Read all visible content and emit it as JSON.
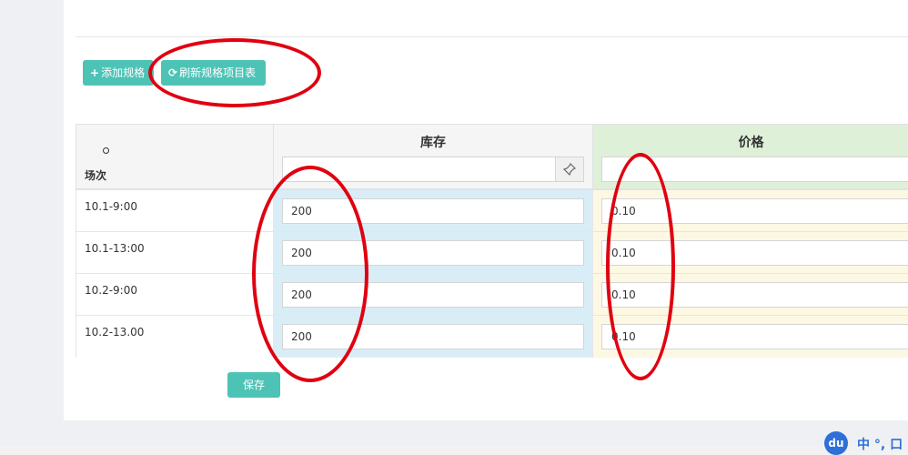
{
  "toolbar": {
    "add_label": "添加规格",
    "add_icon": "plus-icon",
    "refresh_label": "刷新规格项目表",
    "refresh_icon": "refresh-icon"
  },
  "table": {
    "row_header_label": "场次",
    "columns": [
      {
        "title": "库存"
      },
      {
        "title": "价格"
      }
    ],
    "rows": [
      {
        "name": "10.1-9:00",
        "stock": "200",
        "price": "0.10"
      },
      {
        "name": "10.1-13:00",
        "stock": "200",
        "price": "0.10"
      },
      {
        "name": "10.2-9:00",
        "stock": "200",
        "price": "0.10"
      },
      {
        "name": "10.2-13.00",
        "stock": "200",
        "price": "0.10"
      }
    ]
  },
  "actions": {
    "save_label": "保存"
  },
  "ime": {
    "logo": "du",
    "text": "中 °, 口"
  },
  "colors": {
    "accent": "#4dc3b6",
    "annotation": "#e00010",
    "stock_bg": "#d9edf7",
    "price_bg": "#fcf8e3",
    "price_header_bg": "#dff0d8"
  }
}
